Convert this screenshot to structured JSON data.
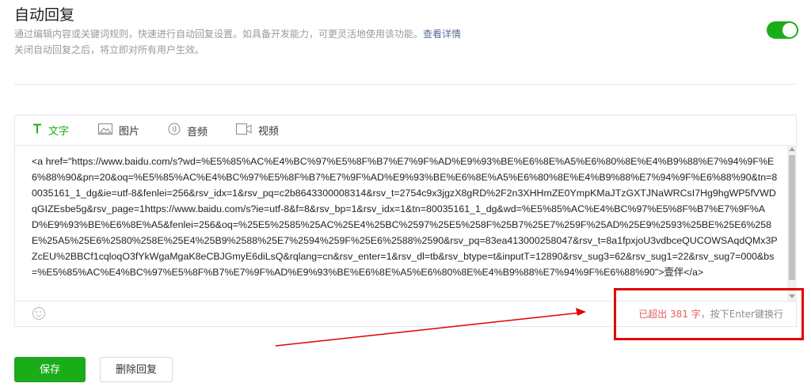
{
  "header": {
    "title": "自动回复",
    "description_main": "通过编辑内容或关键词规则，快速进行自动回复设置。如具备开发能力，可更灵活地使用该功能。",
    "description_link": "查看详情",
    "description_sub": "关闭自动回复之后，将立即对所有用户生效。",
    "toggle_on": true
  },
  "editor": {
    "tabs": [
      {
        "label": "文字",
        "icon": "text-icon",
        "active": true
      },
      {
        "label": "图片",
        "icon": "image-icon",
        "active": false
      },
      {
        "label": "音频",
        "icon": "audio-icon",
        "active": false
      },
      {
        "label": "视频",
        "icon": "video-icon",
        "active": false
      }
    ],
    "content": "<a href=\"https://www.baidu.com/s?wd=%E5%85%AC%E4%BC%97%E5%8F%B7%E7%9F%AD%E9%93%BE%E6%8E%A5%E6%80%8E%E4%B9%88%E7%94%9F%E6%88%90&pn=20&oq=%E5%85%AC%E4%BC%97%E5%8F%B7%E7%9F%AD%E9%93%BE%E6%8E%A5%E6%80%8E%E4%B9%88%E7%94%9F%E6%88%90&tn=80035161_1_dg&ie=utf-8&fenlei=256&rsv_idx=1&rsv_pq=c2b8643300008314&rsv_t=2754c9x3jgzX8gRD%2F2n3XHHmZE0YmpKMaJTzGXTJNaWRCsI7Hg9hgWP5fVWDqGIZEsbe5g&rsv_page=1https://www.baidu.com/s?ie=utf-8&f=8&rsv_bp=1&rsv_idx=1&tn=80035161_1_dg&wd=%E5%85%AC%E4%BC%97%E5%8F%B7%E7%9F%AD%E9%93%BE%E6%8E%A5&fenlei=256&oq=%25E5%2585%25AC%25E4%25BC%2597%25E5%258F%25B7%25E7%259F%25AD%25E9%2593%25BE%25E6%258E%25A5%25E6%2580%258E%25E4%25B9%2588%25E7%2594%259F%25E6%2588%2590&rsv_pq=83ea413000258047&rsv_t=8a1fpxjoU3vdbceQUCOWSAqdQMx3PZcEU%2BBCf1cqloqO3fYkWgaMgaK8eCBJGmyE6diLsQ&rqlang=cn&rsv_enter=1&rsv_dl=tb&rsv_btype=t&inputT=12890&rsv_sug3=62&rsv_sug1=22&rsv_sug7=000&bs=%E5%85%AC%E4%BC%97%E5%8F%B7%E7%9F%AD%E9%93%BE%E6%8E%A5%E6%80%8E%E4%B9%88%E7%94%9F%E6%88%90\">壹伴</a>",
    "counter_prefix": "已超出 381 字",
    "counter_suffix": "，按下Enter键换行"
  },
  "actions": {
    "save_label": "保存",
    "delete_label": "删除回复"
  },
  "colors": {
    "accent": "#1aad19",
    "link": "#576b95",
    "warning": "#e15f63",
    "annotation": "#e30000"
  }
}
